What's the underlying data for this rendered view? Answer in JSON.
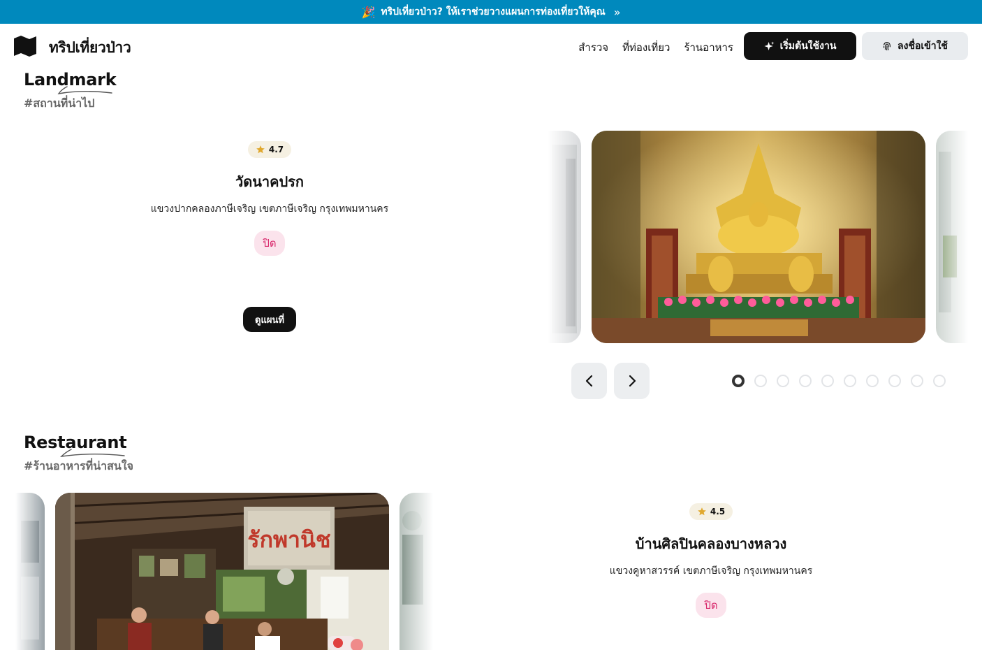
{
  "banner": {
    "text": "ทริปเที่ยวป่าว? ให้เราช่วยวางแผนการท่องเที่ยวให้คุณ",
    "emoji": "🎉",
    "chevron": "»"
  },
  "brand": {
    "name": "ทริปเที่ยวป่าว",
    "logo_icon": "folded-map-icon"
  },
  "nav": {
    "links": [
      "สำรวจ",
      "ที่ท่องเที่ยว",
      "ร้านอาหาร"
    ],
    "start_label": "เริ่มต้นใช้งาน",
    "start_icon": "sparkle-icon",
    "login_label": "ลงชื่อเข้าใช้",
    "login_icon": "fingerprint-icon"
  },
  "landmark": {
    "title": "Landmark",
    "subtitle": "#สถานที่น่าไป",
    "rating": "4.7",
    "name": "วัดนาคปรก",
    "address": "แขวงปากคลองภาษีเจริญ เขตภาษีเจริญ กรุงเทพมหานคร",
    "status": "ปิด",
    "map_button": "ดูแผนที่",
    "dots_total": 10,
    "active_dot": 0
  },
  "restaurant": {
    "title": "Restaurant",
    "subtitle": "#ร้านอาหารที่น่าสนใจ",
    "rating": "4.5",
    "name": "บ้านศิลปินคลองบางหลวง",
    "address": "แขวงคูหาสวรรค์ เขตภาษีเจริญ กรุงเทพมหานคร",
    "status": "ปิด",
    "sign_text": "รักพานิช"
  },
  "colors": {
    "banner": "#0089bd",
    "dark": "#111111",
    "status_bg": "#fbe3ec",
    "status_text": "#d8266a",
    "rating_bg": "#f5f0e2",
    "star": "#e0a82e"
  }
}
